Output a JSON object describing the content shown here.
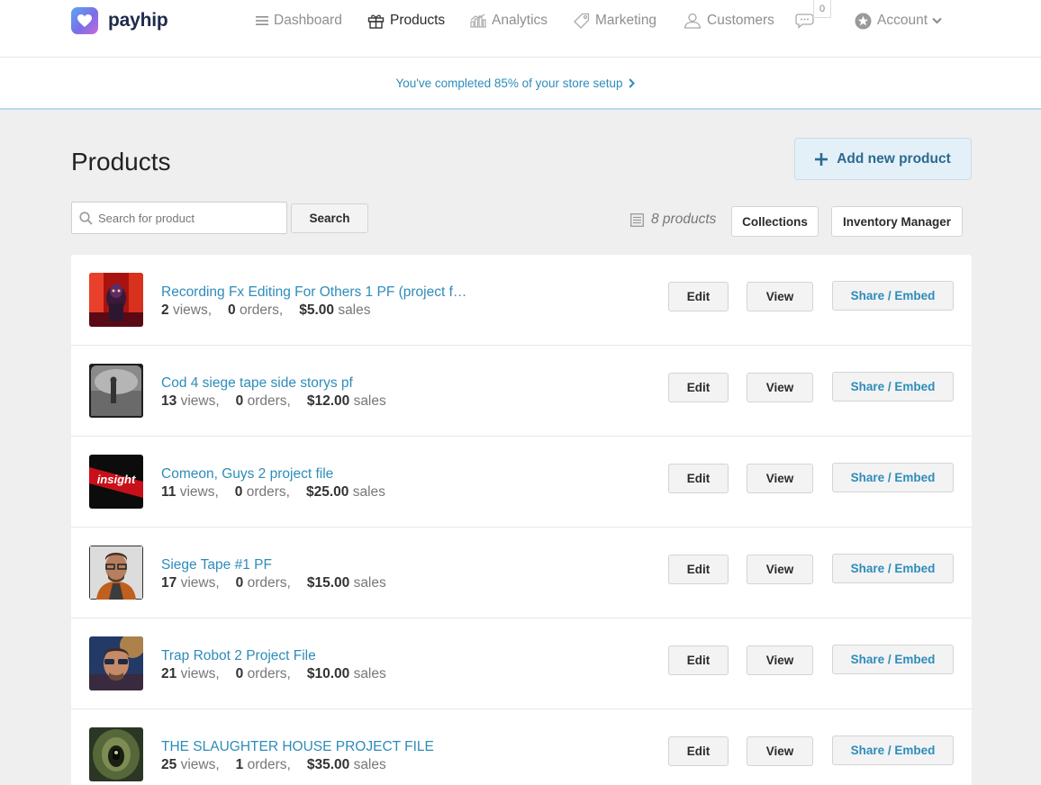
{
  "brand": {
    "name": "payhip",
    "color": "#2e8cba"
  },
  "nav": {
    "dashboard": "Dashboard",
    "products": "Products",
    "analytics": "Analytics",
    "marketing": "Marketing",
    "customers": "Customers",
    "messages_count": "0",
    "account": "Account"
  },
  "setup": {
    "text": "You've completed 85% of your store setup",
    "progress_percent": 85
  },
  "page": {
    "title": "Products",
    "add_button": "Add new product"
  },
  "search": {
    "placeholder": "Search for product",
    "value": "",
    "button": "Search"
  },
  "toolbar": {
    "count": "8 products",
    "collections": "Collections",
    "inventory": "Inventory Manager"
  },
  "row_actions": {
    "edit": "Edit",
    "view": "View",
    "share": "Share / Embed"
  },
  "stat_labels": {
    "views": "views,",
    "orders": "orders,",
    "sales": "sales"
  },
  "products": [
    {
      "title": "Recording Fx Editing For Others 1 PF (project fi...",
      "views": "2",
      "orders": "0",
      "sales": "$5.00"
    },
    {
      "title": "Cod 4 siege tape side storys pf",
      "views": "13",
      "orders": "0",
      "sales": "$12.00"
    },
    {
      "title": "Comeon, Guys 2 project file",
      "views": "11",
      "orders": "0",
      "sales": "$25.00",
      "thumb_text": "insight"
    },
    {
      "title": "Siege Tape #1 PF",
      "views": "17",
      "orders": "0",
      "sales": "$15.00"
    },
    {
      "title": "Trap Robot 2 Project File",
      "views": "21",
      "orders": "0",
      "sales": "$10.00"
    },
    {
      "title": "THE SLAUGHTER HOUSE PROJECT FILE",
      "views": "25",
      "orders": "1",
      "sales": "$35.00"
    }
  ]
}
